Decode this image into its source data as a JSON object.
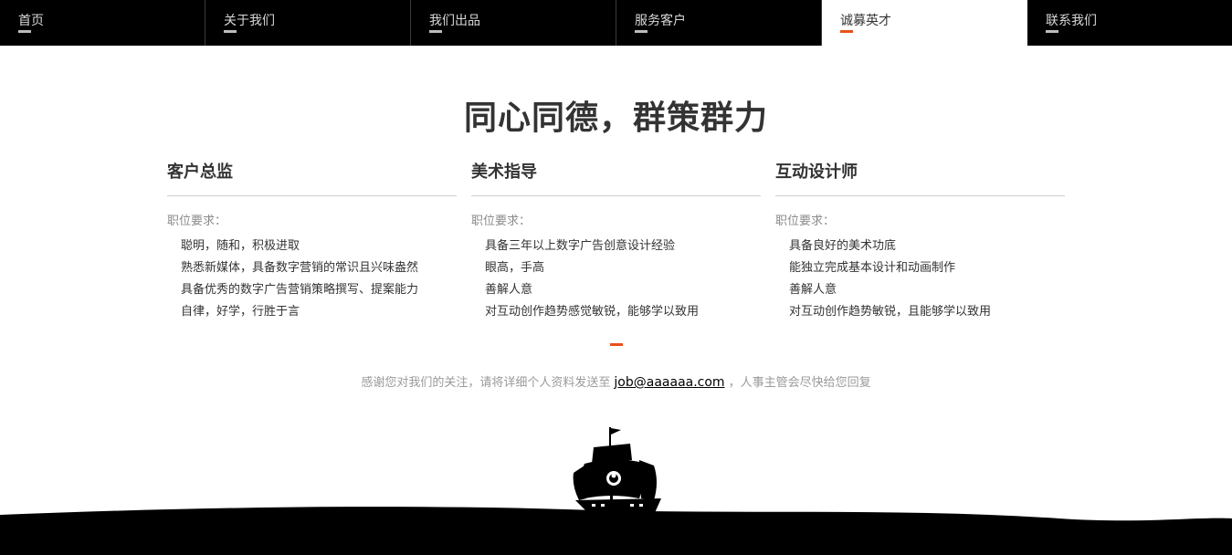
{
  "nav": {
    "items": [
      {
        "label": "首页",
        "active": false
      },
      {
        "label": "关于我们",
        "active": false
      },
      {
        "label": "我们出品",
        "active": false
      },
      {
        "label": "服务客户",
        "active": false
      },
      {
        "label": "诚募英才",
        "active": true
      },
      {
        "label": "联系我们",
        "active": false
      }
    ]
  },
  "headline": "同心同德，群策群力",
  "jobs": [
    {
      "title": "客户总监",
      "req_label": "职位要求：",
      "requirements": [
        "聪明，随和，积极进取",
        "熟悉新媒体，具备数字营销的常识且兴味盎然",
        "具备优秀的数字广告营销策略撰写、提案能力",
        "自律，好学，行胜于言"
      ]
    },
    {
      "title": "美术指导",
      "req_label": "职位要求：",
      "requirements": [
        "具备三年以上数字广告创意设计经验",
        "眼高，手高",
        "善解人意",
        "对互动创作趋势感觉敏锐，能够学以致用"
      ]
    },
    {
      "title": "互动设计师",
      "req_label": "职位要求：",
      "requirements": [
        "具备良好的美术功底",
        "能独立完成基本设计和动画制作",
        "善解人意",
        "对互动创作趋势敏锐，且能够学以致用"
      ]
    }
  ],
  "contact": {
    "before": "感谢您对我们的关注，请将详细个人资料发送至",
    "email": "job@aaaaaa.com",
    "after": "，人事主管会尽快给您回复"
  },
  "colors": {
    "accent": "#e8501c",
    "nav_bg": "#000000",
    "text": "#333333"
  },
  "icons": {
    "footer": "pirate-ship-icon"
  }
}
